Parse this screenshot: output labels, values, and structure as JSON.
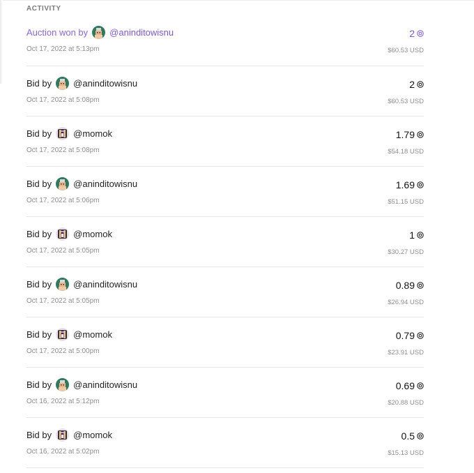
{
  "section": {
    "title": "ACTIVITY"
  },
  "activity": [
    {
      "type": "won",
      "label": "Auction won by",
      "avatar": "tezos-avatar-aninditowisnu",
      "handle": "@aninditowisnu",
      "date": "Oct 17, 2022 at 5:13pm",
      "amount": "2",
      "usd": "$60.53 USD"
    },
    {
      "type": "bid",
      "label": "Bid by",
      "avatar": "tezos-avatar-aninditowisnu",
      "handle": "@aninditowisnu",
      "date": "Oct 17, 2022 at 5:08pm",
      "amount": "2",
      "usd": "$60.53 USD"
    },
    {
      "type": "bid",
      "label": "Bid by",
      "avatar": "tezos-avatar-momok",
      "handle": "@momok",
      "date": "Oct 17, 2022 at 5:08pm",
      "amount": "1.79",
      "usd": "$54.18 USD"
    },
    {
      "type": "bid",
      "label": "Bid by",
      "avatar": "tezos-avatar-aninditowisnu",
      "handle": "@aninditowisnu",
      "date": "Oct 17, 2022 at 5:06pm",
      "amount": "1.69",
      "usd": "$51.15 USD"
    },
    {
      "type": "bid",
      "label": "Bid by",
      "avatar": "tezos-avatar-momok",
      "handle": "@momok",
      "date": "Oct 17, 2022 at 5:05pm",
      "amount": "1",
      "usd": "$30.27 USD"
    },
    {
      "type": "bid",
      "label": "Bid by",
      "avatar": "tezos-avatar-aninditowisnu",
      "handle": "@aninditowisnu",
      "date": "Oct 17, 2022 at 5:05pm",
      "amount": "0.89",
      "usd": "$26.94 USD"
    },
    {
      "type": "bid",
      "label": "Bid by",
      "avatar": "tezos-avatar-momok",
      "handle": "@momok",
      "date": "Oct 17, 2022 at 5:00pm",
      "amount": "0.79",
      "usd": "$23.91 USD"
    },
    {
      "type": "bid",
      "label": "Bid by",
      "avatar": "tezos-avatar-aninditowisnu",
      "handle": "@aninditowisnu",
      "date": "Oct 16, 2022 at 5:12pm",
      "amount": "0.69",
      "usd": "$20.88 USD"
    },
    {
      "type": "bid",
      "label": "Bid by",
      "avatar": "tezos-avatar-momok",
      "handle": "@momok",
      "date": "Oct 16, 2022 at 5:02pm",
      "amount": "0.5",
      "usd": "$15.13 USD"
    }
  ],
  "colors": {
    "accent": "#7b57d6",
    "muted": "#8e8e8e",
    "divider": "#e6e6e6"
  },
  "icons": {
    "currency": "tezos-icon"
  }
}
